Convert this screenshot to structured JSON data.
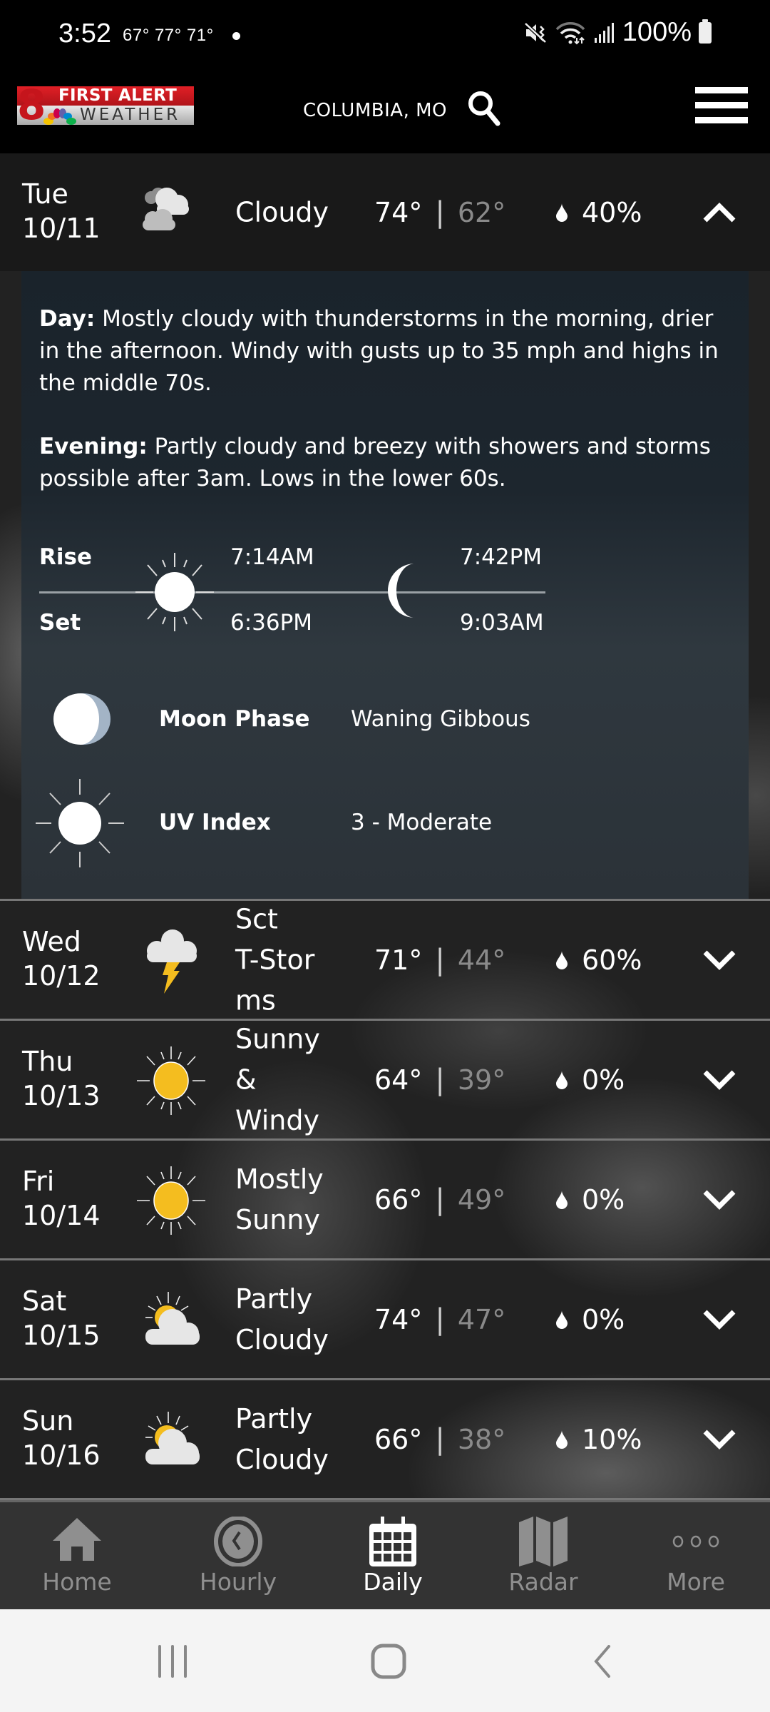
{
  "status_bar": {
    "time": "3:52",
    "weather_temps": "67°  77°  71°",
    "battery": "100%",
    "icons": [
      "mute-vibrate-icon",
      "wifi-icon",
      "signal-icon",
      "battery-icon"
    ]
  },
  "header": {
    "logo_line1": "FIRST ALERT",
    "logo_line2": "WEATHER",
    "logo_number": "8",
    "location": "COLUMBIA, MO",
    "search_icon": "search-icon",
    "menu_icon": "hamburger-menu-icon"
  },
  "colors": {
    "logo_red": "#d81e25",
    "sun_yellow": "#f4bd1f",
    "low_temp_gray": "#8a8a8a",
    "tab_inactive": "#8f8f8f",
    "tab_active": "#ffffff",
    "detail_panel": "#1d262e"
  },
  "forecast": [
    {
      "day": "Tue",
      "date": "10/11",
      "icon": "cloudy-icon",
      "condition": "Cloudy",
      "high": "74°",
      "low": "62°",
      "precip": "40%",
      "expanded": true
    },
    {
      "day": "Wed",
      "date": "10/12",
      "icon": "thunderstorm-icon",
      "condition": "Sct T-Storms",
      "condition_lines": [
        "Sct",
        "T-Stor",
        "ms"
      ],
      "high": "71°",
      "low": "44°",
      "precip": "60%",
      "expanded": false
    },
    {
      "day": "Thu",
      "date": "10/13",
      "icon": "sunny-icon",
      "condition": "Sunny & Windy",
      "condition_lines": [
        "Sunny",
        "&",
        "Windy"
      ],
      "high": "64°",
      "low": "39°",
      "precip": "0%",
      "expanded": false
    },
    {
      "day": "Fri",
      "date": "10/14",
      "icon": "sunny-icon",
      "condition": "Mostly Sunny",
      "condition_lines": [
        "Mostly",
        "Sunny"
      ],
      "high": "66°",
      "low": "49°",
      "precip": "0%",
      "expanded": false
    },
    {
      "day": "Sat",
      "date": "10/15",
      "icon": "partly-cloudy-icon",
      "condition": "Partly Cloudy",
      "condition_lines": [
        "Partly",
        "Cloudy"
      ],
      "high": "74°",
      "low": "47°",
      "precip": "0%",
      "expanded": false
    },
    {
      "day": "Sun",
      "date": "10/16",
      "icon": "partly-cloudy-icon",
      "condition": "Partly Cloudy",
      "condition_lines": [
        "Partly",
        "Cloudy"
      ],
      "high": "66°",
      "low": "38°",
      "precip": "10%",
      "expanded": false
    }
  ],
  "detail": {
    "day_label": "Day:",
    "day_text": "Mostly cloudy with thunderstorms in the morning, drier in the afternoon. Windy with gusts up to 35 mph and highs in the middle 70s.",
    "evening_label": "Evening:",
    "evening_text": "Partly cloudy and breezy with showers and storms possible after 3am. Lows in the lower 60s.",
    "rise_label": "Rise",
    "set_label": "Set",
    "sunrise": "7:14AM",
    "sunset": "6:36PM",
    "moonrise": "7:42PM",
    "moonset": "9:03AM",
    "moon_phase_label": "Moon Phase",
    "moon_phase_value": "Waning Gibbous",
    "uv_label": "UV Index",
    "uv_value": "3 - Moderate"
  },
  "tabs": [
    {
      "label": "Home",
      "icon": "home-icon",
      "active": false
    },
    {
      "label": "Hourly",
      "icon": "clock-icon",
      "active": false
    },
    {
      "label": "Daily",
      "icon": "calendar-icon",
      "active": true
    },
    {
      "label": "Radar",
      "icon": "map-icon",
      "active": false
    },
    {
      "label": "More",
      "icon": "more-dots-icon",
      "active": false
    }
  ],
  "system_nav": [
    "recent-apps-icon",
    "home-circle-icon",
    "back-icon"
  ]
}
